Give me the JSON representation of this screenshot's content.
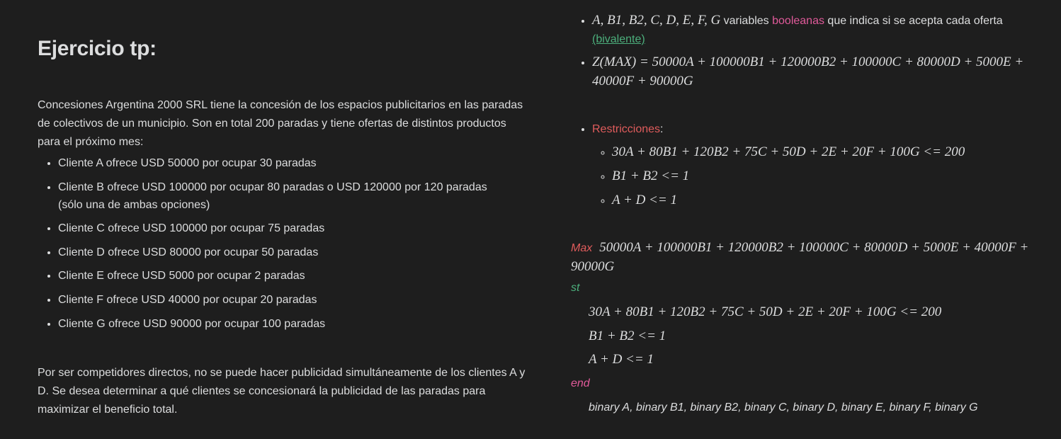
{
  "left": {
    "title": "Ejercicio tp:",
    "intro": "Concesiones Argentina 2000 SRL tiene la concesión de los espacios publicitarios en las paradas de colectivos de un municipio. Son en total 200 paradas y tiene ofertas de distintos productos para el próximo mes:",
    "clients": [
      "Cliente A ofrece USD 50000 por ocupar 30 paradas",
      "Cliente B ofrece USD 100000 por ocupar 80 paradas o USD 120000 por 120 paradas (sólo una de ambas opciones)",
      "Cliente C ofrece USD 100000 por ocupar 75 paradas",
      "Cliente D ofrece USD 80000 por ocupar 50 paradas",
      "Cliente E ofrece USD 5000 por ocupar 2 paradas",
      "Cliente F ofrece USD 40000 por ocupar 20 paradas",
      "Cliente G ofrece USD 90000 por ocupar 100 paradas"
    ],
    "outro": "Por ser competidores directos, no se puede hacer publicidad simultáneamente de los clientes A y D. Se desea determinar a qué clientes se concesionará la publicidad de las paradas para maximizar el beneficio total."
  },
  "right": {
    "vars_math": "A, B1, B2, C, D, E, F, G",
    "vars_text1": " variables ",
    "vars_pink": "booleanas",
    "vars_text2": " que indica si se acepta cada oferta ",
    "vars_green": "(bivalente)",
    "objective": "Z(MAX) = 50000A + 100000B1 + 120000B2 + 100000C + 80000D + 5000E + 40000F + 90000G",
    "restr_label": "Restricciones",
    "restr_colon": ":",
    "constraints": [
      "30A + 80B1 + 120B2 + 75C + 50D + 2E + 20F + 100G <= 200",
      "B1 + B2 <= 1",
      "A + D <= 1"
    ],
    "max_kw": "Max",
    "max_expr": "50000A + 100000B1 + 120000B2 + 100000C + 80000D + 5000E + 40000F + 90000G",
    "st_kw": "st",
    "end_kw": "end",
    "binary_line": "binary A, binary B1, binary B2, binary C, binary D, binary E, binary F, binary G"
  },
  "colors": {
    "background": "#1e1e1e",
    "text": "#dcddde",
    "pink": "#e05a9a",
    "green": "#4caf7c",
    "red": "#e05c5c"
  }
}
